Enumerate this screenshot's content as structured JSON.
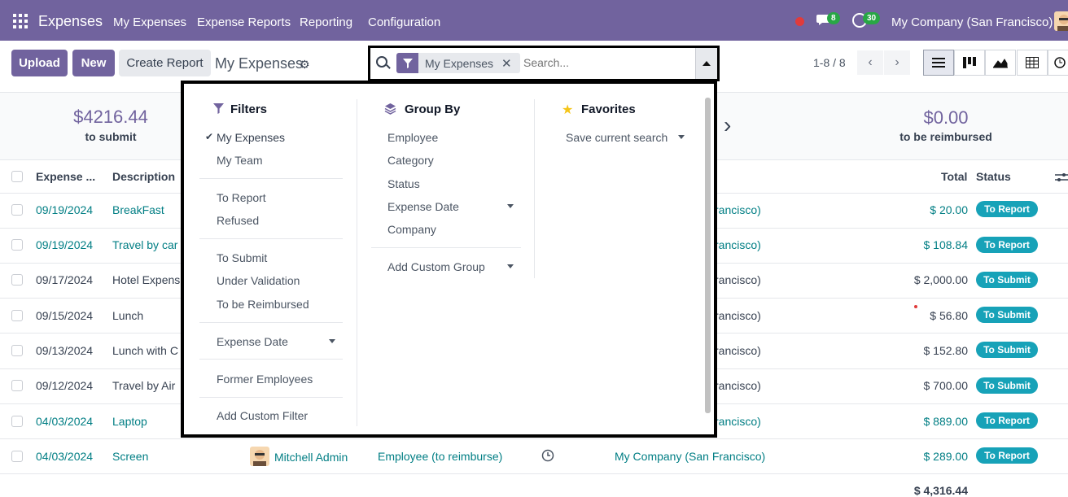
{
  "navbar": {
    "app_name": "Expenses",
    "menu": [
      "My Expenses",
      "Expense Reports",
      "Reporting",
      "Configuration"
    ],
    "chat_count": "8",
    "activity_count": "30",
    "company": "My Company (San Francisco)",
    "colors": {
      "bar": "#71639e",
      "badge": "#28a745",
      "status_dot": "#e03b3b"
    }
  },
  "control": {
    "upload_label": "Upload",
    "new_label": "New",
    "create_report_label": "Create Report",
    "breadcrumb": "My Expenses",
    "search": {
      "facet": "My Expenses",
      "placeholder": "Search..."
    },
    "pager": "1-8 / 8"
  },
  "summary": {
    "to_submit_amount": "$4216.44",
    "to_submit_label": "to submit",
    "reimbursed_amount": "$0.00",
    "reimbursed_label": "to be reimbursed"
  },
  "table": {
    "headers": {
      "expense": "Expense ...",
      "description": "Description",
      "total": "Total",
      "status": "Status"
    },
    "rows": [
      {
        "date": "09/19/2024",
        "desc": "BreakFast",
        "company": "rancisco)",
        "total": "$ 20.00",
        "status": "To Report",
        "linked": true
      },
      {
        "date": "09/19/2024",
        "desc": "Travel by car",
        "company": "rancisco)",
        "total": "$ 108.84",
        "status": "To Report",
        "linked": true
      },
      {
        "date": "09/17/2024",
        "desc": "Hotel Expens",
        "company": "rancisco)",
        "total": "$ 2,000.00",
        "status": "To Submit",
        "linked": false
      },
      {
        "date": "09/15/2024",
        "desc": "Lunch",
        "company": "rancisco)",
        "total": "$ 56.80",
        "status": "To Submit",
        "linked": false
      },
      {
        "date": "09/13/2024",
        "desc": "Lunch with C",
        "company": "rancisco)",
        "total": "$ 152.80",
        "status": "To Submit",
        "linked": false
      },
      {
        "date": "09/12/2024",
        "desc": "Travel by Air",
        "company": "rancisco)",
        "total": "$ 700.00",
        "status": "To Submit",
        "linked": false
      },
      {
        "date": "04/03/2024",
        "desc": "Laptop",
        "company": "rancisco)",
        "total": "$ 889.00",
        "status": "To Report",
        "linked": true
      },
      {
        "date": "04/03/2024",
        "desc": "Screen",
        "employee": "Mitchell Admin",
        "paid_by": "Employee (to reimburse)",
        "company": "My Company (San Francisco)",
        "total": "$ 289.00",
        "status": "To Report",
        "linked": true
      }
    ],
    "grand_total": "$ 4,316.44"
  },
  "dropdown": {
    "filters": {
      "title": "Filters",
      "items": [
        "My Expenses",
        "My Team",
        "To Report",
        "Refused",
        "To Submit",
        "Under Validation",
        "To be Reimbursed",
        "Expense Date",
        "Former Employees",
        "Add Custom Filter"
      ]
    },
    "groupby": {
      "title": "Group By",
      "items": [
        "Employee",
        "Category",
        "Status",
        "Expense Date",
        "Company",
        "Add Custom Group"
      ]
    },
    "favorites": {
      "title": "Favorites",
      "items": [
        "Save current search"
      ]
    }
  }
}
